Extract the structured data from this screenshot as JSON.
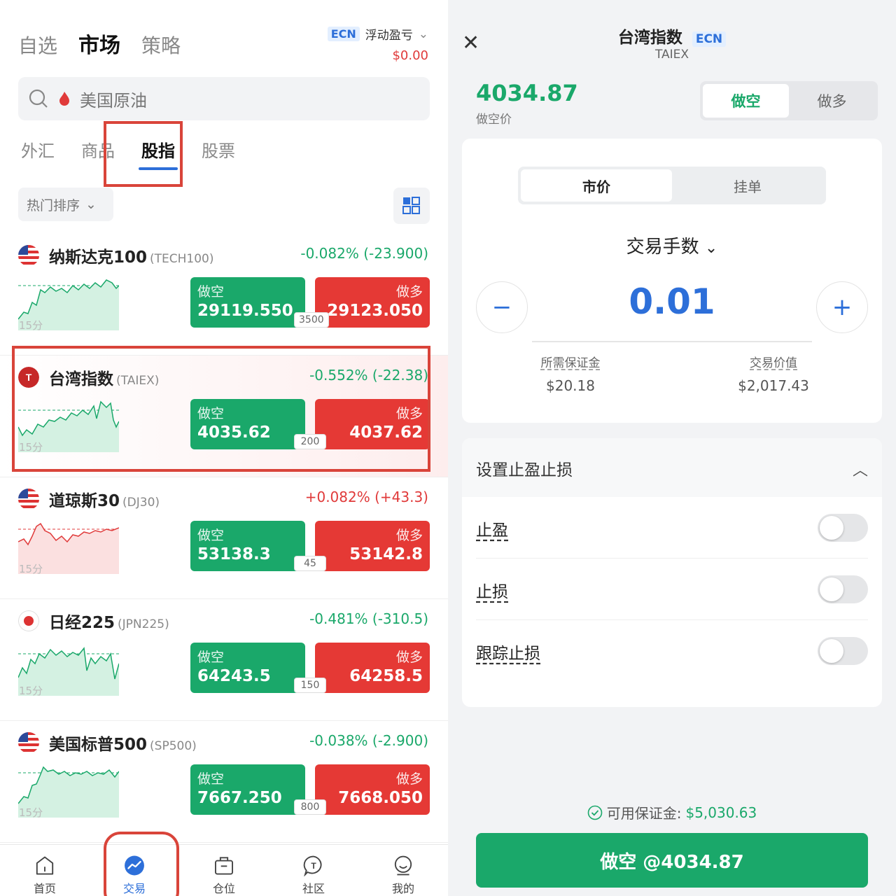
{
  "left": {
    "top_tabs": [
      {
        "label": "自选",
        "active": false
      },
      {
        "label": "市场",
        "active": true
      },
      {
        "label": "策略",
        "active": false
      }
    ],
    "ecn": {
      "badge": "ECN",
      "label": "浮动盈亏",
      "pnl": "$0.00"
    },
    "search": {
      "placeholder": "美国原油"
    },
    "sub_tabs": [
      {
        "label": "外汇",
        "active": false
      },
      {
        "label": "商品",
        "active": false
      },
      {
        "label": "股指",
        "active": true
      },
      {
        "label": "股票",
        "active": false
      }
    ],
    "sort_label": "热门排序",
    "spark_label": "15分",
    "sell_label": "做空",
    "buy_label": "做多",
    "instruments": [
      {
        "name": "纳斯达克100",
        "code": "(TECH100)",
        "change": "-0.082% (-23.900)",
        "direction": "down",
        "sell": "29119.550",
        "buy": "29123.050",
        "spread": "3500",
        "flag": "US100"
      },
      {
        "name": "台湾指数",
        "code": "(TAIEX)",
        "change": "-0.552% (-22.38)",
        "direction": "down",
        "sell": "4035.62",
        "buy": "4037.62",
        "spread": "200",
        "flag": "TAIEX"
      },
      {
        "name": "道琼斯30",
        "code": "(DJ30)",
        "change": "+0.082% (+43.3)",
        "direction": "up",
        "sell": "53138.3",
        "buy": "53142.8",
        "spread": "45",
        "flag": "US30"
      },
      {
        "name": "日经225",
        "code": "(JPN225)",
        "change": "-0.481% (-310.5)",
        "direction": "down",
        "sell": "64243.5",
        "buy": "64258.5",
        "spread": "150",
        "flag": "J225"
      },
      {
        "name": "美国标普500",
        "code": "(SP500)",
        "change": "-0.038% (-2.900)",
        "direction": "down",
        "sell": "7667.250",
        "buy": "7668.050",
        "spread": "800",
        "flag": "US500"
      }
    ],
    "bottom_nav": [
      {
        "label": "首页",
        "icon": "home-icon",
        "active": false
      },
      {
        "label": "交易",
        "icon": "trade-icon",
        "active": true
      },
      {
        "label": "仓位",
        "icon": "position-icon",
        "active": false
      },
      {
        "label": "社区",
        "icon": "community-icon",
        "active": false
      },
      {
        "label": "我的",
        "icon": "profile-icon",
        "active": false
      }
    ]
  },
  "right": {
    "title": "台湾指数",
    "badge": "ECN",
    "subtitle": "TAIEX",
    "price": "4034.87",
    "price_label": "做空价",
    "direction_options": [
      "做空",
      "做多"
    ],
    "order_types": [
      "市价",
      "挂单"
    ],
    "lot_label": "交易手数",
    "lot_value": "0.01",
    "margin_label": "所需保证金",
    "margin_value": "$20.18",
    "value_label": "交易价值",
    "value_value": "$2,017.43",
    "sltp_title": "设置止盈止损",
    "sltp_rows": [
      "止盈",
      "止损",
      "跟踪止损"
    ],
    "avail_label": "可用保证金:",
    "avail_value": "$5,030.63",
    "submit_label": "做空 @4034.87"
  },
  "colors": {
    "green": "#1aa86a",
    "red": "#e53935",
    "blue": "#2d6fd9",
    "highlight": "#d9443a"
  }
}
